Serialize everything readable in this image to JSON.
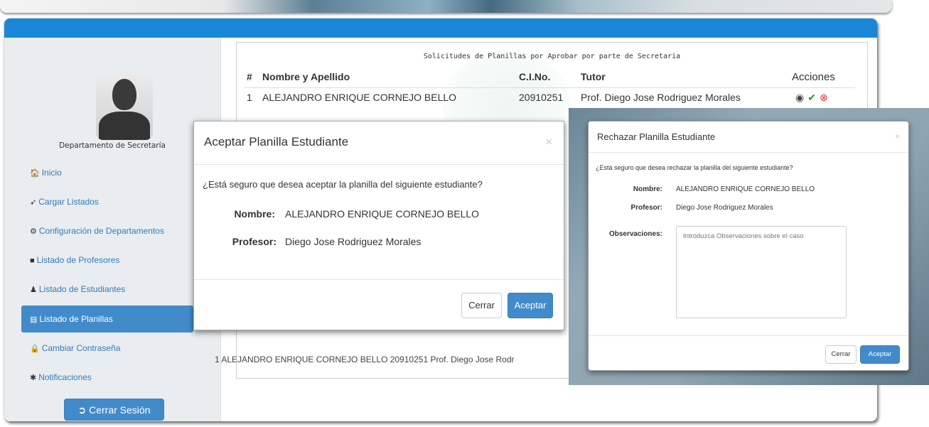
{
  "sidebar": {
    "department": "Departamento de Secretaría",
    "items": [
      {
        "label": "Inicio",
        "icon": "home-icon",
        "glyph": "🏠"
      },
      {
        "label": "Cargar Listados",
        "icon": "send-icon",
        "glyph": "➶"
      },
      {
        "label": "Configuración de Departamentos",
        "icon": "gear-icon",
        "glyph": "⚙"
      },
      {
        "label": "Listado de Profesores",
        "icon": "book-icon",
        "glyph": "■"
      },
      {
        "label": "Listado de Estudiantes",
        "icon": "user-icon",
        "glyph": "♟"
      },
      {
        "label": "Listado de Planillas",
        "icon": "list-icon",
        "glyph": "▤",
        "active": true
      },
      {
        "label": "Cambiar Contraseña",
        "icon": "lock-icon",
        "glyph": "🔒"
      },
      {
        "label": "Notificaciones",
        "icon": "asterisk-icon",
        "glyph": "✱"
      }
    ],
    "logout_label": "Cerrar Sesión",
    "logout_glyph": "➲"
  },
  "table": {
    "title": "Solicitudes de Planillas por Aprobar por parte de Secretaria",
    "headers": [
      "#",
      "Nombre y Apellido",
      "C.I.No.",
      "Tutor",
      "Acciones"
    ],
    "rows": [
      [
        "1",
        "ALEJANDRO ENRIQUE CORNEJO BELLO",
        "20910251",
        "Prof. Diego Jose Rodriguez Morales"
      ]
    ],
    "bg_row": "1   ALEJANDRO ENRIQUE CORNEJO BELLO        20910251    Prof. Diego Jose Rodr"
  },
  "modal_accept": {
    "title": "Aceptar Planilla Estudiante",
    "close": "×",
    "question": "¿Está seguro que desea aceptar la planilla del siguiente estudiante?",
    "name_label": "Nombre:",
    "name_value": "ALEJANDRO ENRIQUE CORNEJO BELLO",
    "prof_label": "Profesor:",
    "prof_value": "Diego Jose Rodriguez Morales",
    "cancel": "Cerrar",
    "accept": "Aceptar"
  },
  "modal_reject": {
    "title": "Rechazar Planilla Estudiante",
    "close": "×",
    "question": "¿Está seguro que desea rechazar la planilla del siguiente estudiante?",
    "name_label": "Nombre:",
    "name_value": "ALEJANDRO ENRIQUE CORNEJO BELLO",
    "prof_label": "Profesor:",
    "prof_value": "Diego Jose Rodriguez Morales",
    "obs_label": "Observaciones:",
    "obs_placeholder": "Introduzca Observaciones sobre el caso",
    "cancel": "Cerrar",
    "accept": "Aceptar"
  },
  "colors": {
    "header_blue": "#1a87d6",
    "active_nav": "#428bca",
    "check_green": "#1c9c2c",
    "reject_red": "#d9302a"
  }
}
